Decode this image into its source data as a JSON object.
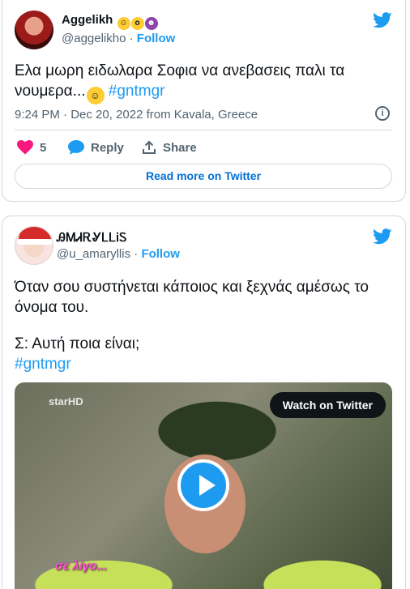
{
  "tweet1": {
    "author_name": "Aggelikh",
    "author_emojis": [
      "halo-face",
      "astonished-face",
      "devil-face"
    ],
    "handle": "@aggelikho",
    "separator": "·",
    "follow_label": "Follow",
    "text": "Ελα μωρη ειδωλαρα Σοφια να ανεβασεις παλι τα νουμερα...",
    "text_emoji": "smirk-face",
    "hashtag": "#gntmgr",
    "timestamp": "9:24 PM · Dec 20, 2022 from Kavala, Greece",
    "like_count": "5",
    "reply_label": "Reply",
    "share_label": "Share",
    "read_more_label": "Read more on Twitter"
  },
  "tweet2": {
    "author_name": "ᎯᎷᏗᎡᎽᏞᏞᎥᏚ",
    "handle": "@u_amaryllis",
    "separator": "·",
    "follow_label": "Follow",
    "text_line1": "Όταν σου συστήνεται κάποιος και ξεχνάς αμέσως το όνομα του.",
    "text_line2": "Σ: Αυτή ποια είναι;",
    "hashtag": "#gntmgr",
    "video": {
      "channel_logo": "starHD",
      "watch_label": "Watch on Twitter",
      "caption": "σε λίγο..."
    }
  },
  "colors": {
    "accent": "#1d9bf0",
    "like": "#f91880",
    "muted": "#536471",
    "border": "#cfd9de"
  }
}
